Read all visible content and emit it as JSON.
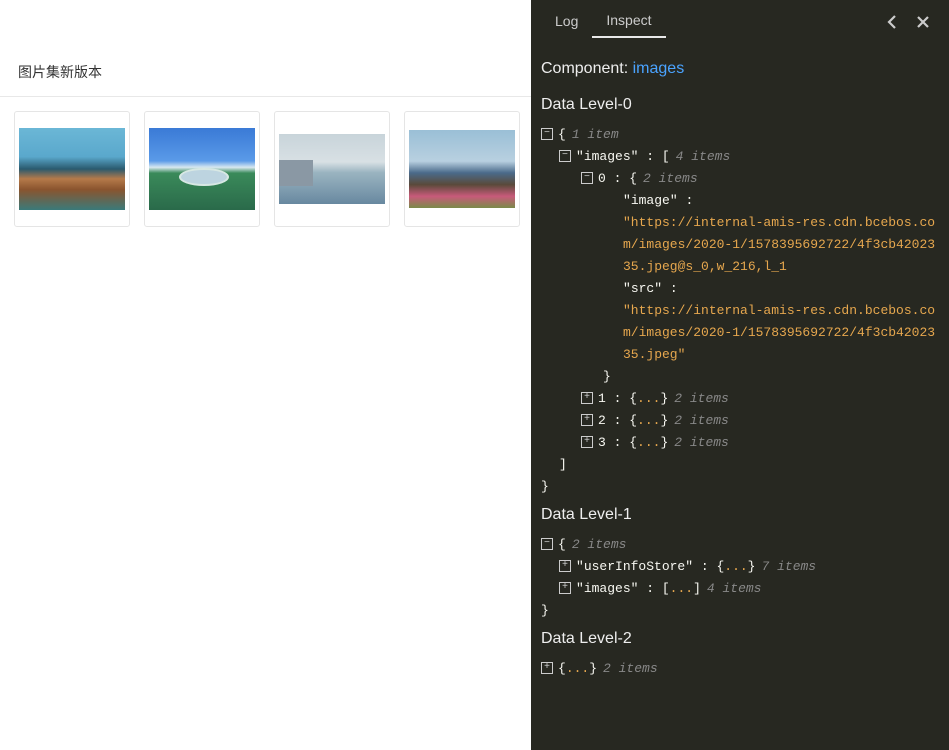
{
  "left": {
    "title": "图片集新版本"
  },
  "tabs": {
    "log": "Log",
    "inspect": "Inspect"
  },
  "component": {
    "label": "Component:",
    "name": "images"
  },
  "levels": {
    "lvl0": "Data Level-0",
    "lvl1": "Data Level-1",
    "lvl2": "Data Level-2"
  },
  "tree0": {
    "root_meta": "1 item",
    "images_key": "images",
    "images_meta": "4 items",
    "item0_idx": "0",
    "item0_meta": "2 items",
    "item0_image_key": "image",
    "item0_image_val": "\"https://internal-amis-res.cdn.bcebos.com/images/2020-1/1578395692722/4f3cb4202335.jpeg@s_0,w_216,l_1",
    "item0_src_key": "src",
    "item0_src_val": "\"https://internal-amis-res.cdn.bcebos.com/images/2020-1/1578395692722/4f3cb4202335.jpeg\"",
    "item1_idx": "1",
    "item1_meta": "2 items",
    "item2_idx": "2",
    "item2_meta": "2 items",
    "item3_idx": "3",
    "item3_meta": "2 items"
  },
  "tree1": {
    "root_meta": "2 items",
    "userInfo_key": "userInfoStore",
    "userInfo_meta": "7 items",
    "images_key": "images",
    "images_meta": "4 items"
  },
  "tree2": {
    "root_meta": "2 items"
  },
  "glyphs": {
    "minus": "−",
    "plus": "+",
    "ellipsis": "..."
  }
}
